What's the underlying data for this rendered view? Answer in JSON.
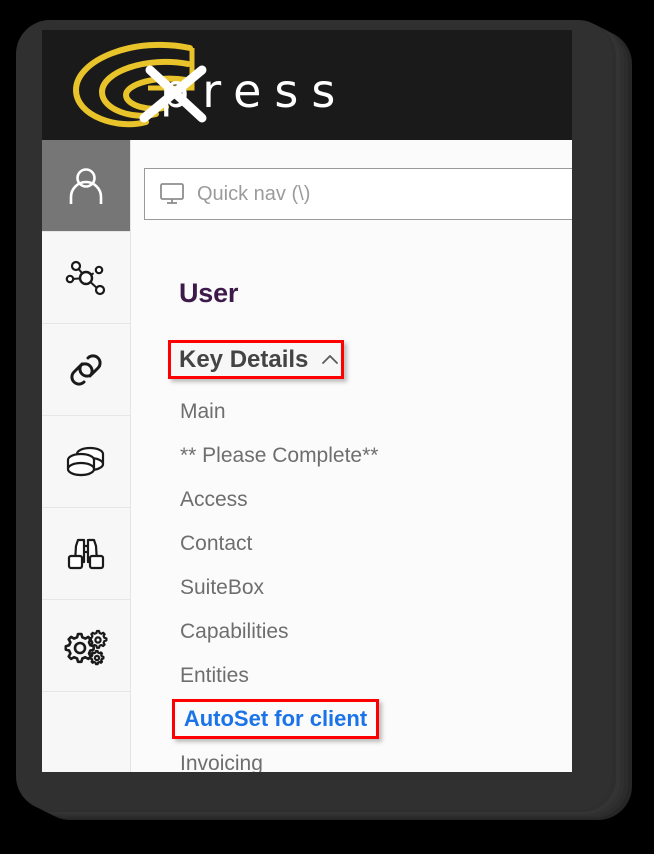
{
  "brand": {
    "wordmark": "press",
    "logo_icon": "xpress-swirl-x-logo",
    "swirl_color": "#e8c32a",
    "x_color": "#ffffff",
    "header_background": "#1a1a1a"
  },
  "icon_rail": {
    "items": [
      {
        "name": "user",
        "icon": "person-icon",
        "active": true
      },
      {
        "name": "network",
        "icon": "network-nodes-icon",
        "active": false
      },
      {
        "name": "links",
        "icon": "chain-link-icon",
        "active": false
      },
      {
        "name": "finance",
        "icon": "coins-stack-icon",
        "active": false
      },
      {
        "name": "search-wide",
        "icon": "binoculars-icon",
        "active": false
      },
      {
        "name": "settings",
        "icon": "gears-icon",
        "active": false
      }
    ]
  },
  "search": {
    "placeholder": "Quick nav (\\)",
    "leading_icon": "monitor-icon",
    "trailing_icon": "search-icon"
  },
  "page": {
    "title": "User",
    "title_color": "#3d1a4a"
  },
  "section": {
    "label": "Key Details",
    "chevron": "chevron-up-icon",
    "expanded": true,
    "annotation_color": "#ff0000"
  },
  "nav": {
    "items": [
      {
        "label": "Main",
        "highlighted": false
      },
      {
        "label": "** Please Complete**",
        "highlighted": false
      },
      {
        "label": "Access",
        "highlighted": false
      },
      {
        "label": "Contact",
        "highlighted": false
      },
      {
        "label": "SuiteBox",
        "highlighted": false
      },
      {
        "label": "Capabilities",
        "highlighted": false
      },
      {
        "label": "Entities",
        "highlighted": false
      },
      {
        "label": "AutoSet for client",
        "highlighted": true
      },
      {
        "label": "Invoicing",
        "highlighted": false
      }
    ],
    "highlight_text_color": "#1a73e8",
    "annotation_color": "#ff0000"
  }
}
